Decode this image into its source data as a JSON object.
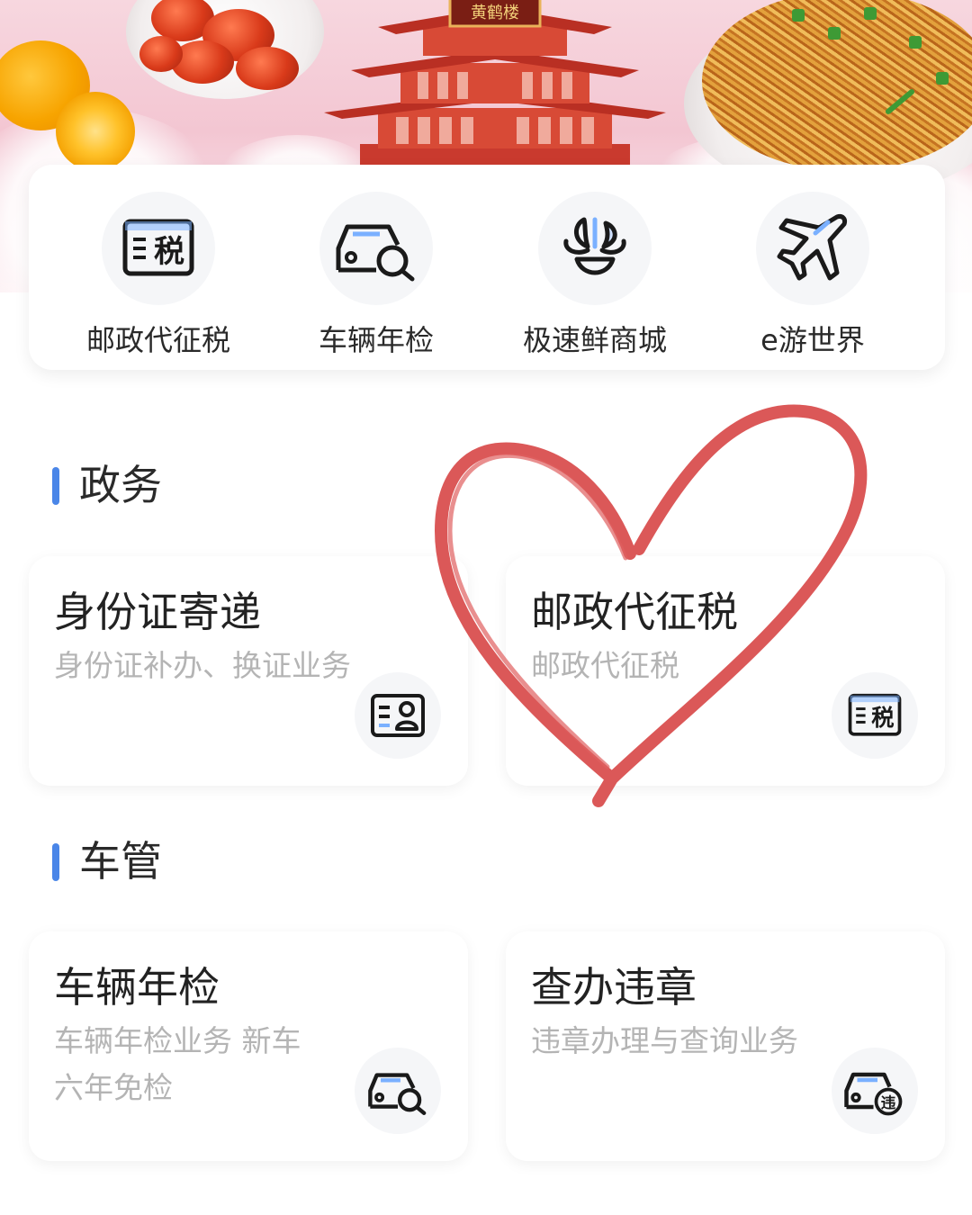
{
  "banner": {
    "tower_sign": "黄鹤楼"
  },
  "shortcuts": [
    {
      "label": "邮政代征税",
      "icon": "tax-icon"
    },
    {
      "label": "车辆年检",
      "icon": "car-inspection-icon"
    },
    {
      "label": "极速鲜商城",
      "icon": "fresh-mall-icon"
    },
    {
      "label": "e游世界",
      "icon": "plane-icon"
    }
  ],
  "sections": [
    {
      "title": "政务",
      "cards": [
        {
          "title": "身份证寄递",
          "desc": "身份证补办、换证业务",
          "icon": "id-card-icon"
        },
        {
          "title": "邮政代征税",
          "desc": "邮政代征税",
          "icon": "tax-icon"
        }
      ]
    },
    {
      "title": "车管",
      "cards": [
        {
          "title": "车辆年检",
          "desc": "车辆年检业务 新车六年免检",
          "icon": "car-inspection-icon"
        },
        {
          "title": "查办违章",
          "desc": "违章办理与查询业务",
          "icon": "car-violation-icon"
        }
      ]
    }
  ],
  "icon_glyphs": {
    "tax": "税",
    "violation": "违"
  },
  "colors": {
    "accent": "#4a86e8",
    "heart": "#d84a4a",
    "muted_text": "#b4b4b4"
  }
}
